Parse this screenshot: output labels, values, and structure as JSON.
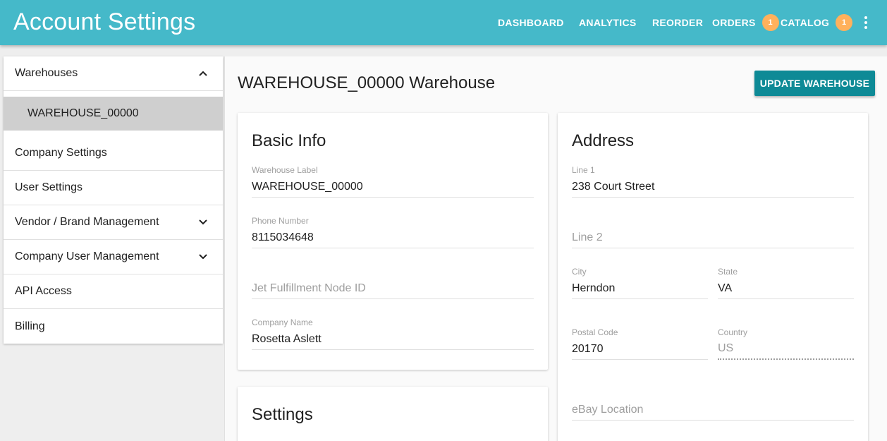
{
  "app": {
    "title": "Account Settings"
  },
  "nav": {
    "dashboard": "DASHBOARD",
    "analytics": "ANALYTICS",
    "reorder": "REORDER",
    "orders": "ORDERS",
    "orders_badge": "1",
    "catalog": "CATALOG",
    "catalog_badge": "1",
    "more_icon": "more-vert-icon"
  },
  "sidebar": {
    "items": [
      {
        "label": "Warehouses",
        "icon": "chevron-up-icon"
      },
      {
        "label": "WAREHOUSE_00000",
        "selected": true
      },
      {
        "label": "Company Settings"
      },
      {
        "label": "User Settings"
      },
      {
        "label": "Vendor / Brand Management",
        "icon": "chevron-down-icon"
      },
      {
        "label": "Company User Management",
        "icon": "chevron-down-icon"
      },
      {
        "label": "API Access"
      },
      {
        "label": "Billing"
      }
    ]
  },
  "main": {
    "title": "WAREHOUSE_00000 Warehouse",
    "update_button": "UPDATE WAREHOUSE"
  },
  "basic_info": {
    "title": "Basic Info",
    "warehouse_label": {
      "label": "Warehouse Label",
      "value": "WAREHOUSE_00000"
    },
    "phone_number": {
      "label": "Phone Number",
      "value": "8115034648"
    },
    "jet_node": {
      "placeholder": "Jet Fulfillment Node ID"
    },
    "company_name": {
      "label": "Company Name",
      "value": "Rosetta Aslett"
    }
  },
  "settings": {
    "title": "Settings"
  },
  "address": {
    "title": "Address",
    "line1": {
      "label": "Line 1",
      "value": "238 Court Street"
    },
    "line2": {
      "placeholder": "Line 2"
    },
    "city": {
      "label": "City",
      "value": "Herndon"
    },
    "state": {
      "label": "State",
      "value": "VA"
    },
    "postal_code": {
      "label": "Postal Code",
      "value": "20170"
    },
    "country": {
      "label": "Country",
      "value": "US"
    },
    "ebay_location": {
      "placeholder": "eBay Location"
    }
  },
  "colors": {
    "topbar": "#45b9c9",
    "badge": "#ffb15c",
    "primary_button": "#0e8a96",
    "selected_item": "#cfcfcf"
  }
}
